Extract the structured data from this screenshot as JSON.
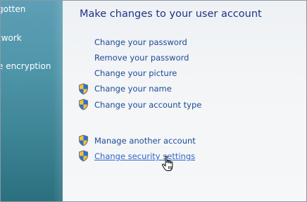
{
  "sidebar": {
    "items": [
      {
        "label": "gotten"
      },
      {
        "label": "twork"
      },
      {
        "label": "e encryption"
      }
    ]
  },
  "main": {
    "title": "Make changes to your user account",
    "tasks": [
      {
        "label": "Change your password",
        "icon": "none"
      },
      {
        "label": "Remove your password",
        "icon": "none"
      },
      {
        "label": "Change your picture",
        "icon": "none"
      },
      {
        "label": "Change your name",
        "icon": "uac-shield-icon"
      },
      {
        "label": "Change your account type",
        "icon": "uac-shield-icon"
      },
      {
        "label": "Manage another account",
        "icon": "uac-shield-icon"
      },
      {
        "label": "Change security settings",
        "icon": "uac-shield-icon",
        "state": "hovered"
      }
    ]
  },
  "colors": {
    "link": "#1e4a96",
    "link_hover": "#2f67c9",
    "title": "#1e3287",
    "sidebar": "#4f95a8"
  }
}
